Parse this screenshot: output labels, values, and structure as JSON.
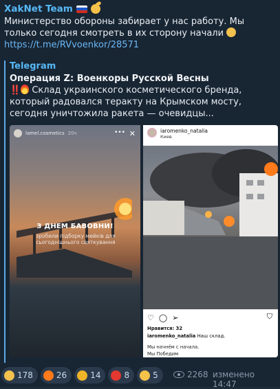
{
  "message": {
    "author": "XakNet Team",
    "text": "Министерство обороны забирает у нас работу. Мы только сегодня смотреть в их сторону начали",
    "link": "https://t.me/RVvoenkor/28571"
  },
  "forward": {
    "source": "Telegram",
    "title": "Операция Z: Военкоры Русской Весны",
    "bangs": "‼️",
    "text": "Склад украинского косметического бренда, который радовался теракту на Крымском мосту, сегодня уничтожила ракета — очевидцы..."
  },
  "media_left": {
    "story_user": "lamel.cosmetics",
    "story_time": "20ч",
    "caption_big": "З ДНЕМ БАВОВНИ!",
    "caption_small": "зробили підборку мейків для сьогоднішнього святкування"
  },
  "media_right": {
    "username": "iaromenko_natalia",
    "location": "Киев",
    "likes": "Нравится: 32",
    "caption_user": "iaromenko_natalia",
    "caption_text": "Наш склад.",
    "line1": "Мы начнём с начала.",
    "line2": "Мы Победим"
  },
  "reactions": [
    {
      "icon": "grin-emoji-icon",
      "count": "178",
      "color": "#f2c14e"
    },
    {
      "icon": "fire-emoji-icon",
      "count": "26",
      "color": "#ff7a1a"
    },
    {
      "icon": "trophy-emoji-icon",
      "count": "14",
      "color": "#f0b429"
    },
    {
      "icon": "heart-fire-emoji-icon",
      "count": "8",
      "color": "#e3382f"
    },
    {
      "icon": "thumbs-up-emoji-icon",
      "count": "5",
      "color": "#f4c14a"
    }
  ],
  "views": "2268",
  "edited": "изменено 14:47",
  "colors": {
    "accent": "#57b9f6",
    "link": "#6ab7f5",
    "background": "#182533"
  }
}
